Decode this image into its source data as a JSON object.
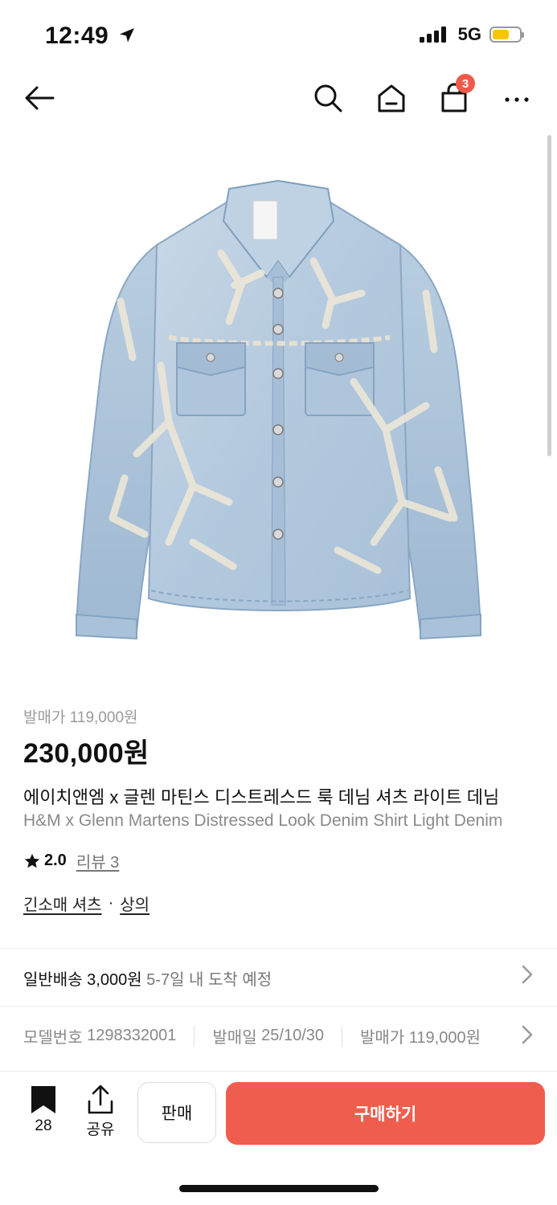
{
  "status_bar": {
    "time": "12:49",
    "network": "5G"
  },
  "nav": {
    "cart_count": "3"
  },
  "product": {
    "release_label": "발매가",
    "release_price": "119,000원",
    "price": "230,000원",
    "name_ko": "에이치앤엠 x 글렌 마틴스 디스트레스드 룩 데님 셔츠 라이트 데님",
    "name_en": "H&M x Glenn Martens Distressed Look Denim Shirt Light Denim",
    "rating": "2.0",
    "review_label": "리뷰 3",
    "categories": [
      "긴소매 셔츠",
      "상의"
    ],
    "category_sep": "·"
  },
  "shipping": {
    "method": "일반배송 3,000원",
    "eta": "5-7일 내 도착 예정"
  },
  "meta": {
    "model_label": "모델번호",
    "model_value": "1298332001",
    "date_label": "발매일",
    "date_value": "25/10/30",
    "price_label": "발매가",
    "price_value": "119,000원"
  },
  "bottom_bar": {
    "bookmark_count": "28",
    "share_label": "공유",
    "sell_label": "판매",
    "buy_label": "구매하기"
  },
  "colors": {
    "accent": "#ef5d4e",
    "badge": "#ee5a4a",
    "battery": "#f7c600"
  },
  "icons": [
    "location-arrow-icon",
    "signal-icon",
    "battery-icon",
    "back-arrow-icon",
    "search-icon",
    "home-icon",
    "shopping-bag-icon",
    "more-icon",
    "star-icon",
    "chevron-right-icon",
    "bookmark-icon",
    "share-icon"
  ]
}
